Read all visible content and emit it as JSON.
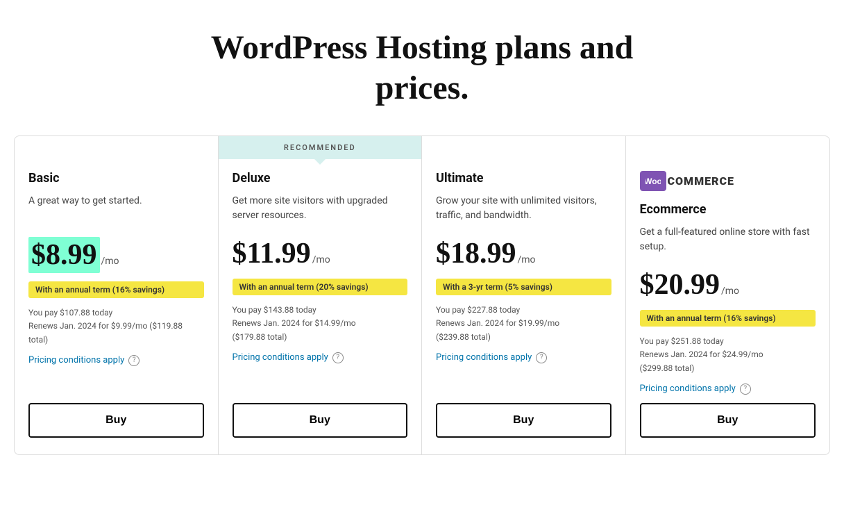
{
  "page": {
    "title_line1": "WordPress Hosting plans and",
    "title_line2": "prices."
  },
  "plans": [
    {
      "id": "basic",
      "recommended": false,
      "show_padding": true,
      "name": "Basic",
      "description": "A great way to get started.",
      "price": "$8.99",
      "period": "/mo",
      "price_highlighted": true,
      "savings": "With an annual term (16% savings)",
      "billing_line1": "You pay $107.88 today",
      "billing_line2": "Renews Jan. 2024 for $9.99/mo ($119.88",
      "billing_line3": "total)",
      "pricing_conditions": "Pricing conditions apply",
      "buy_label": "Buy",
      "woo": false
    },
    {
      "id": "deluxe",
      "recommended": true,
      "show_padding": false,
      "name": "Deluxe",
      "description": "Get more site visitors with upgraded server resources.",
      "price": "$11.99",
      "period": "/mo",
      "price_highlighted": false,
      "savings": "With an annual term (20% savings)",
      "billing_line1": "You pay $143.88 today",
      "billing_line2": "Renews Jan. 2024 for $14.99/mo",
      "billing_line3": "($179.88 total)",
      "pricing_conditions": "Pricing conditions apply",
      "buy_label": "Buy",
      "woo": false
    },
    {
      "id": "ultimate",
      "recommended": false,
      "show_padding": true,
      "name": "Ultimate",
      "description": "Grow your site with unlimited visitors, traffic, and bandwidth.",
      "price": "$18.99",
      "period": "/mo",
      "price_highlighted": false,
      "savings": "With a 3-yr term (5% savings)",
      "billing_line1": "You pay $227.88 today",
      "billing_line2": "Renews Jan. 2024 for $19.99/mo",
      "billing_line3": "($239.88 total)",
      "pricing_conditions": "Pricing conditions apply",
      "buy_label": "Buy",
      "woo": false
    },
    {
      "id": "ecommerce",
      "recommended": false,
      "show_padding": true,
      "name": "Ecommerce",
      "description": "Get a full-featured online store with fast setup.",
      "price": "$20.99",
      "period": "/mo",
      "price_highlighted": false,
      "savings": "With an annual term (16% savings)",
      "billing_line1": "You pay $251.88 today",
      "billing_line2": "Renews Jan. 2024 for $24.99/mo",
      "billing_line3": "($299.88 total)",
      "pricing_conditions": "Pricing conditions apply",
      "buy_label": "Buy",
      "woo": true,
      "woo_bag": "w",
      "woo_commerce": "COMMERCE"
    }
  ],
  "recommended_label": "RECOMMENDED",
  "help_icon_label": "?"
}
